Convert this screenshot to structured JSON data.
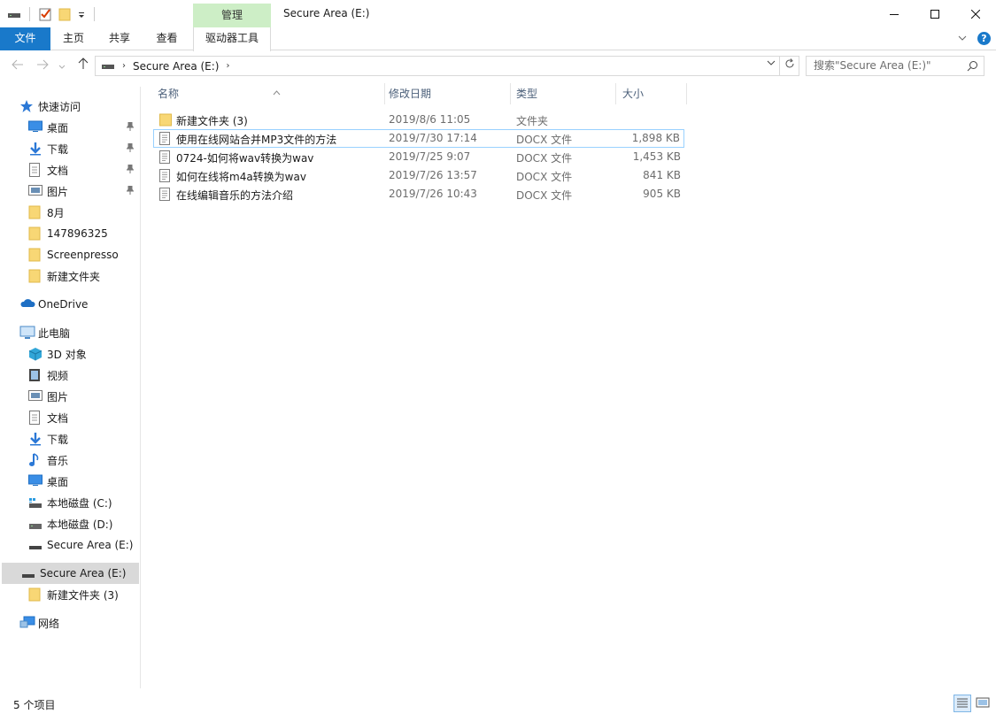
{
  "window": {
    "title": "Secure Area (E:)",
    "manage_tab": "管理"
  },
  "ribbon": {
    "tabs": [
      "文件",
      "主页",
      "共享",
      "查看",
      "驱动器工具"
    ]
  },
  "address": {
    "path_segment": "Secure Area (E:)",
    "search_placeholder": "搜索\"Secure Area (E:)\""
  },
  "sidebar": {
    "quick_access": "快速访问",
    "quick_items": [
      {
        "label": "桌面",
        "icon": "desktop-icon",
        "pinned": true
      },
      {
        "label": "下载",
        "icon": "download-icon",
        "pinned": true
      },
      {
        "label": "文档",
        "icon": "document-icon",
        "pinned": true
      },
      {
        "label": "图片",
        "icon": "picture-icon",
        "pinned": true
      },
      {
        "label": "8月",
        "icon": "folder-icon",
        "pinned": false
      },
      {
        "label": "147896325",
        "icon": "folder-icon",
        "pinned": false
      },
      {
        "label": "Screenpresso",
        "icon": "folder-icon",
        "pinned": false
      },
      {
        "label": "新建文件夹",
        "icon": "folder-icon",
        "pinned": false
      }
    ],
    "onedrive": "OneDrive",
    "this_pc": "此电脑",
    "pc_items": [
      {
        "label": "3D 对象",
        "icon": "3d-objects-icon"
      },
      {
        "label": "视频",
        "icon": "video-icon"
      },
      {
        "label": "图片",
        "icon": "picture-icon"
      },
      {
        "label": "文档",
        "icon": "document-icon"
      },
      {
        "label": "下载",
        "icon": "download-icon"
      },
      {
        "label": "音乐",
        "icon": "music-icon"
      },
      {
        "label": "桌面",
        "icon": "desktop-icon"
      },
      {
        "label": "本地磁盘 (C:)",
        "icon": "drive-icon"
      },
      {
        "label": "本地磁盘 (D:)",
        "icon": "drive-icon"
      },
      {
        "label": "Secure Area (E:)",
        "icon": "drive-icon"
      }
    ],
    "selected_drive": "Secure Area (E:)",
    "drive_child": "新建文件夹 (3)",
    "network": "网络"
  },
  "columns": {
    "name": "名称",
    "date": "修改日期",
    "type": "类型",
    "size": "大小"
  },
  "files": [
    {
      "name": "新建文件夹 (3)",
      "date": "2019/8/6 11:05",
      "type": "文件夹",
      "size": "",
      "kind": "folder"
    },
    {
      "name": "使用在线网站合并MP3文件的方法",
      "date": "2019/7/30 17:14",
      "type": "DOCX 文件",
      "size": "1,898 KB",
      "kind": "doc"
    },
    {
      "name": "0724-如何将wav转换为wav",
      "date": "2019/7/25 9:07",
      "type": "DOCX 文件",
      "size": "1,453 KB",
      "kind": "doc"
    },
    {
      "name": "如何在线将m4a转换为wav",
      "date": "2019/7/26 13:57",
      "type": "DOCX 文件",
      "size": "841 KB",
      "kind": "doc"
    },
    {
      "name": "在线编辑音乐的方法介绍",
      "date": "2019/7/26 10:43",
      "type": "DOCX 文件",
      "size": "905 KB",
      "kind": "doc"
    }
  ],
  "status": {
    "item_count": "5 个项目"
  },
  "colors": {
    "file_tab": "#1979ca",
    "manage_tab": "#cdeec6",
    "selection": "#d9d9d9",
    "hover_border": "#99d1ff"
  }
}
